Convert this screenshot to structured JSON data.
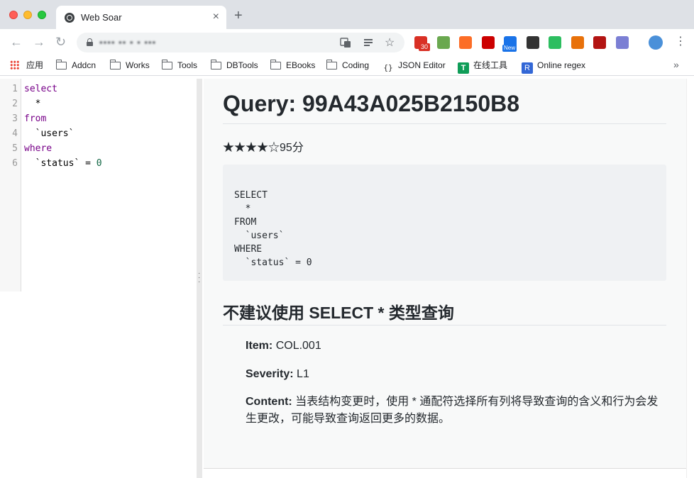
{
  "browser": {
    "tab_title": "Web Soar",
    "tab_close": "×",
    "new_tab": "+",
    "url": "▪▪▪▪       ▪▪   ▪ ▪ ▪▪▪",
    "nav": {
      "back": "←",
      "forward": "→",
      "reload": "↻"
    },
    "extensions": [
      {
        "name": "gmail",
        "color": "#d93025",
        "badge": "30"
      },
      {
        "name": "tampermonkey",
        "color": "#6aa84f"
      },
      {
        "name": "gitlab",
        "color": "#fc6d26"
      },
      {
        "name": "fe-helper",
        "color": "#cc0000"
      },
      {
        "name": "new-ext",
        "color": "#1a73e8",
        "badge": "New"
      },
      {
        "name": "m-ext",
        "color": "#333333"
      },
      {
        "name": "evernote",
        "color": "#2dbe60"
      },
      {
        "name": "puzzle",
        "color": "#e8710a"
      },
      {
        "name": "timer",
        "color": "#b31412"
      },
      {
        "name": "settings",
        "color": "#7b7fd4"
      }
    ],
    "bookmarks": [
      {
        "label": "应用",
        "icon": "apps-grid-icon"
      },
      {
        "label": "Addcn",
        "icon": "folder-icon"
      },
      {
        "label": "Works",
        "icon": "folder-icon"
      },
      {
        "label": "Tools",
        "icon": "folder-icon"
      },
      {
        "label": "DBTools",
        "icon": "folder-icon"
      },
      {
        "label": "EBooks",
        "icon": "folder-icon"
      },
      {
        "label": "Coding",
        "icon": "folder-icon"
      },
      {
        "label": "JSON Editor",
        "icon": "braces-icon"
      },
      {
        "label": "在线工具",
        "icon": "t-icon"
      },
      {
        "label": "Online regex",
        "icon": "r-icon"
      }
    ],
    "bookmarks_more": "»"
  },
  "editor": {
    "lines": [
      {
        "n": "1",
        "parts": [
          {
            "t": "select",
            "k": "kw"
          }
        ]
      },
      {
        "n": "2",
        "parts": [
          {
            "t": "  *",
            "k": ""
          }
        ]
      },
      {
        "n": "3",
        "parts": [
          {
            "t": "from",
            "k": "kw"
          }
        ]
      },
      {
        "n": "4",
        "parts": [
          {
            "t": "  `users`",
            "k": ""
          }
        ]
      },
      {
        "n": "5",
        "parts": [
          {
            "t": "where",
            "k": "kw"
          }
        ]
      },
      {
        "n": "6",
        "parts": [
          {
            "t": "  `status` = ",
            "k": ""
          },
          {
            "t": "0",
            "k": "num"
          }
        ]
      }
    ]
  },
  "report": {
    "title": "Query: 99A43A025B2150B8",
    "stars": "★★★★☆",
    "score": "95分",
    "formatted_sql": [
      "SELECT",
      "  *",
      "FROM",
      "  `users`",
      "WHERE",
      "  `status` = 0"
    ],
    "heuristic_title": "不建议使用 SELECT * 类型查询",
    "item_label": "Item:",
    "item_value": "COL.001",
    "severity_label": "Severity:",
    "severity_value": "L1",
    "content_label": "Content:",
    "content_value": "当表结构变更时，使用 * 通配符选择所有列将导致查询的含义和行为会发生更改，可能导致查询返回更多的数据。"
  }
}
